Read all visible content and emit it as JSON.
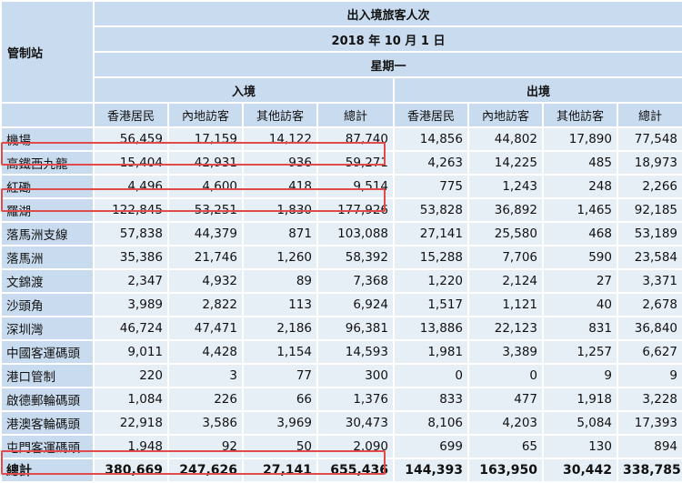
{
  "header": {
    "station_label": "管制站",
    "title": "出入境旅客人次",
    "date": "2018 年 10 月 1 日",
    "weekday": "星期一",
    "arrivals": "入境",
    "departures": "出境",
    "columns": [
      "香港居民",
      "內地訪客",
      "其他訪客",
      "總計",
      "香港居民",
      "內地訪客",
      "其他訪客",
      "總計"
    ]
  },
  "rows": [
    {
      "name": "機場",
      "values": [
        "56,459",
        "17,159",
        "14,122",
        "87,740",
        "14,856",
        "44,802",
        "17,890",
        "77,548"
      ]
    },
    {
      "name": "高鐵西九龍",
      "values": [
        "15,404",
        "42,931",
        "936",
        "59,271",
        "4,263",
        "14,225",
        "485",
        "18,973"
      ]
    },
    {
      "name": "紅磡",
      "values": [
        "4,496",
        "4,600",
        "418",
        "9,514",
        "775",
        "1,243",
        "248",
        "2,266"
      ]
    },
    {
      "name": "羅湖",
      "values": [
        "122,845",
        "53,251",
        "1,830",
        "177,926",
        "53,828",
        "36,892",
        "1,465",
        "92,185"
      ]
    },
    {
      "name": "落馬洲支線",
      "values": [
        "57,838",
        "44,379",
        "871",
        "103,088",
        "27,141",
        "25,580",
        "468",
        "53,189"
      ]
    },
    {
      "name": "落馬洲",
      "values": [
        "35,386",
        "21,746",
        "1,260",
        "58,392",
        "15,288",
        "7,706",
        "590",
        "23,584"
      ]
    },
    {
      "name": "文錦渡",
      "values": [
        "2,347",
        "4,932",
        "89",
        "7,368",
        "1,220",
        "2,124",
        "27",
        "3,371"
      ]
    },
    {
      "name": "沙頭角",
      "values": [
        "3,989",
        "2,822",
        "113",
        "6,924",
        "1,517",
        "1,121",
        "40",
        "2,678"
      ]
    },
    {
      "name": "深圳灣",
      "values": [
        "46,724",
        "47,471",
        "2,186",
        "96,381",
        "13,886",
        "22,123",
        "831",
        "36,840"
      ]
    },
    {
      "name": "中國客運碼頭",
      "values": [
        "9,011",
        "4,428",
        "1,154",
        "14,593",
        "1,981",
        "3,389",
        "1,257",
        "6,627"
      ]
    },
    {
      "name": "港口管制",
      "values": [
        "220",
        "3",
        "77",
        "300",
        "0",
        "0",
        "9",
        "9"
      ]
    },
    {
      "name": "啟德郵輪碼頭",
      "values": [
        "1,084",
        "226",
        "66",
        "1,376",
        "833",
        "477",
        "1,918",
        "3,228"
      ]
    },
    {
      "name": "港澳客輪碼頭",
      "values": [
        "22,918",
        "3,586",
        "3,969",
        "30,473",
        "8,106",
        "4,203",
        "5,084",
        "17,393"
      ]
    },
    {
      "name": "屯門客運碼頭",
      "values": [
        "1,948",
        "92",
        "50",
        "2,090",
        "699",
        "65",
        "130",
        "894"
      ]
    }
  ],
  "total": {
    "name": "總計",
    "values": [
      "380,669",
      "247,626",
      "27,141",
      "655,436",
      "144,393",
      "163,950",
      "30,442",
      "338,785"
    ]
  },
  "colors": {
    "header_bg": "#c9dcef",
    "cell_bg": "#e6eef6",
    "highlight": "#e04a4a"
  }
}
